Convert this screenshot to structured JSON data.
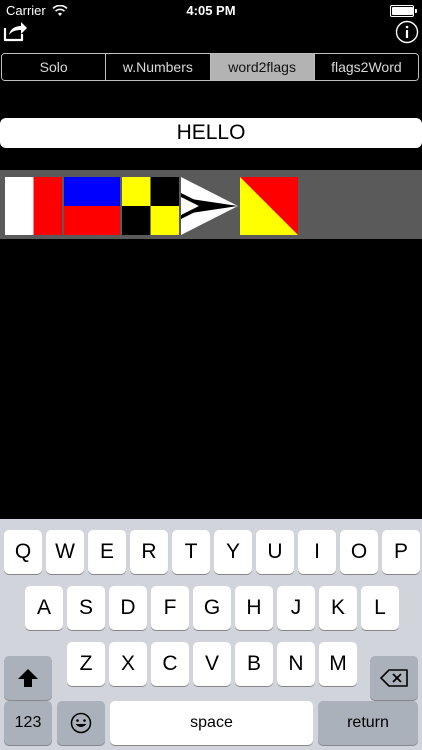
{
  "status_bar": {
    "carrier": "Carrier",
    "time": "4:05 PM",
    "battery_level": 0.95
  },
  "toolbar": {
    "share_icon": "share-icon",
    "info_icon": "info-icon"
  },
  "segments": [
    {
      "label": "Solo",
      "selected": false
    },
    {
      "label": "w.Numbers",
      "selected": false
    },
    {
      "label": "word2flags",
      "selected": true
    },
    {
      "label": "flags2Word",
      "selected": false
    }
  ],
  "word_input": {
    "value": "HELLO"
  },
  "flags": [
    "H",
    "E",
    "L",
    "L",
    "O"
  ],
  "keyboard": {
    "row1": [
      "Q",
      "W",
      "E",
      "R",
      "T",
      "Y",
      "U",
      "I",
      "O",
      "P"
    ],
    "row2": [
      "A",
      "S",
      "D",
      "F",
      "G",
      "H",
      "J",
      "K",
      "L"
    ],
    "row3": [
      "Z",
      "X",
      "C",
      "V",
      "B",
      "N",
      "M"
    ],
    "numbers_label": "123",
    "space_label": "space",
    "return_label": "return",
    "shift_icon": "shift-arrow-icon",
    "emoji_icon": "emoji-face-icon",
    "delete_icon": "backspace-icon"
  },
  "colors": {
    "background": "#000000",
    "selected_segment": "#b3b3b3",
    "flag_strip": "#5a5a5a",
    "keyboard_bg": "#d1d5db",
    "flag_red": "#ff0000",
    "flag_blue": "#0000ff",
    "flag_yellow": "#ffff00"
  }
}
